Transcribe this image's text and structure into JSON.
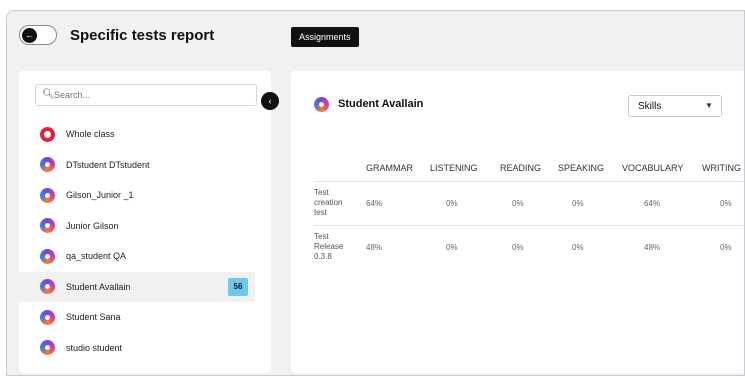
{
  "header": {
    "title": "Specific tests report",
    "assignments_label": "Assignments"
  },
  "sidebar": {
    "search_placeholder": "Search...",
    "items": [
      {
        "label": "Whole class",
        "avatar": "brand-logo-icon",
        "selected": false
      },
      {
        "label": "DTstudent DTstudent",
        "avatar": "student-avatar-icon",
        "selected": false
      },
      {
        "label": "Gilson_Junior _1",
        "avatar": "student-avatar-icon",
        "selected": false
      },
      {
        "label": "Junior Gilson",
        "avatar": "student-avatar-icon",
        "selected": false
      },
      {
        "label": "qa_student QA",
        "avatar": "student-avatar-icon",
        "selected": false
      },
      {
        "label": "Student Avallain",
        "avatar": "student-avatar-icon",
        "selected": true,
        "badge": "56"
      },
      {
        "label": "Student Sana",
        "avatar": "student-avatar-icon",
        "selected": false
      },
      {
        "label": "studio student",
        "avatar": "student-avatar-icon",
        "selected": false
      }
    ]
  },
  "main": {
    "student_name": "Student Avallain",
    "select": {
      "value": "Skills"
    },
    "table": {
      "headers": [
        "",
        "GRAMMAR",
        "LISTENING",
        "READING",
        "SPEAKING",
        "VOCABULARY",
        "WRITING"
      ],
      "rows": [
        {
          "name": [
            "Test",
            "creation",
            "test"
          ],
          "values": [
            "64%",
            "0%",
            "0%",
            "0%",
            "64%",
            "0%"
          ]
        },
        {
          "name": [
            "Test",
            "Release",
            "0.3.8"
          ],
          "values": [
            "48%",
            "0%",
            "0%",
            "0%",
            "48%",
            "0%"
          ]
        }
      ]
    }
  },
  "colors": {
    "frame_bg": "#f1f1f2",
    "accent_dark": "#111111",
    "badge_bg": "#6cc8ef",
    "brand_red": "#e3213b"
  }
}
